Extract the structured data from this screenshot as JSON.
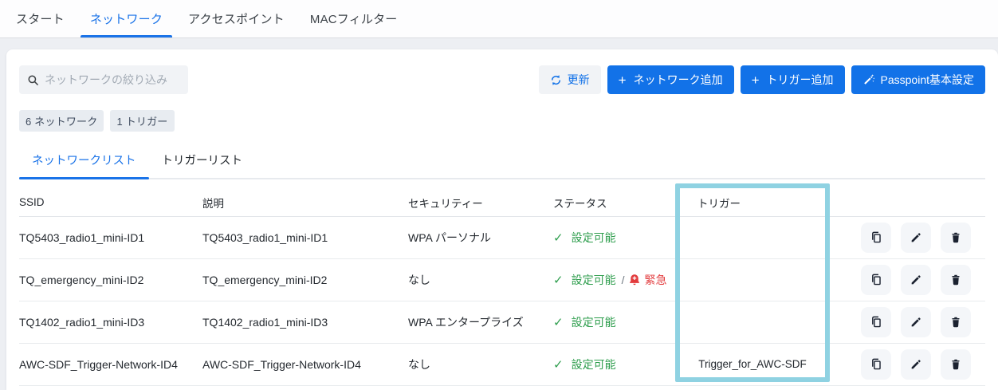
{
  "nav": {
    "tabs": [
      {
        "id": "start",
        "label": "スタート",
        "active": false
      },
      {
        "id": "network",
        "label": "ネットワーク",
        "active": true
      },
      {
        "id": "accesspoint",
        "label": "アクセスポイント",
        "active": false
      },
      {
        "id": "macfilter",
        "label": "MACフィルター",
        "active": false
      }
    ]
  },
  "toolbar": {
    "search_placeholder": "ネットワークの絞り込み",
    "refresh_label": "更新",
    "add_network_label": "ネットワーク追加",
    "add_trigger_label": "トリガー追加",
    "passpoint_label": "Passpoint基本設定"
  },
  "summary_badges": [
    {
      "label": "6 ネットワーク"
    },
    {
      "label": "1 トリガー"
    }
  ],
  "list_tabs": [
    {
      "id": "network-list",
      "label": "ネットワークリスト",
      "active": true
    },
    {
      "id": "trigger-list",
      "label": "トリガーリスト",
      "active": false
    }
  ],
  "labels": {
    "status_separator": "/"
  },
  "glyphs": {
    "plus": "+",
    "check": "✓"
  },
  "table": {
    "columns": [
      "SSID",
      "説明",
      "セキュリティー",
      "ステータス",
      "トリガー"
    ],
    "rows": [
      {
        "ssid": "TQ5403_radio1_mini-ID1",
        "description": "TQ5403_radio1_mini-ID1",
        "security": "WPA パーソナル",
        "status": "設定可能",
        "emergency": false,
        "emergency_label": "",
        "trigger": ""
      },
      {
        "ssid": "TQ_emergency_mini-ID2",
        "description": "TQ_emergency_mini-ID2",
        "security": "なし",
        "status": "設定可能",
        "emergency": true,
        "emergency_label": "緊急",
        "trigger": ""
      },
      {
        "ssid": "TQ1402_radio1_mini-ID3",
        "description": "TQ1402_radio1_mini-ID3",
        "security": "WPA エンタープライズ",
        "status": "設定可能",
        "emergency": false,
        "emergency_label": "",
        "trigger": ""
      },
      {
        "ssid": "AWC-SDF_Trigger-Network-ID4",
        "description": "AWC-SDF_Trigger-Network-ID4",
        "security": "なし",
        "status": "設定可能",
        "emergency": false,
        "emergency_label": "",
        "trigger": "Trigger_for_AWC-SDF"
      }
    ]
  },
  "icons": {
    "search": "magnifier",
    "refresh": "sync-arrows",
    "add": "plus",
    "passpoint": "magic-wand",
    "status_ok": "check",
    "emergency": "bell-plus",
    "copy": "copy-pages",
    "edit": "pencil",
    "delete": "trash"
  },
  "colors": {
    "primary_blue": "#1272e8",
    "tab_active_blue": "#1a73e8",
    "status_green": "#2f9e4e",
    "alert_red": "#e23a3c",
    "highlight_teal": "#8fd2e2",
    "badge_bg": "#e8ecf1"
  }
}
